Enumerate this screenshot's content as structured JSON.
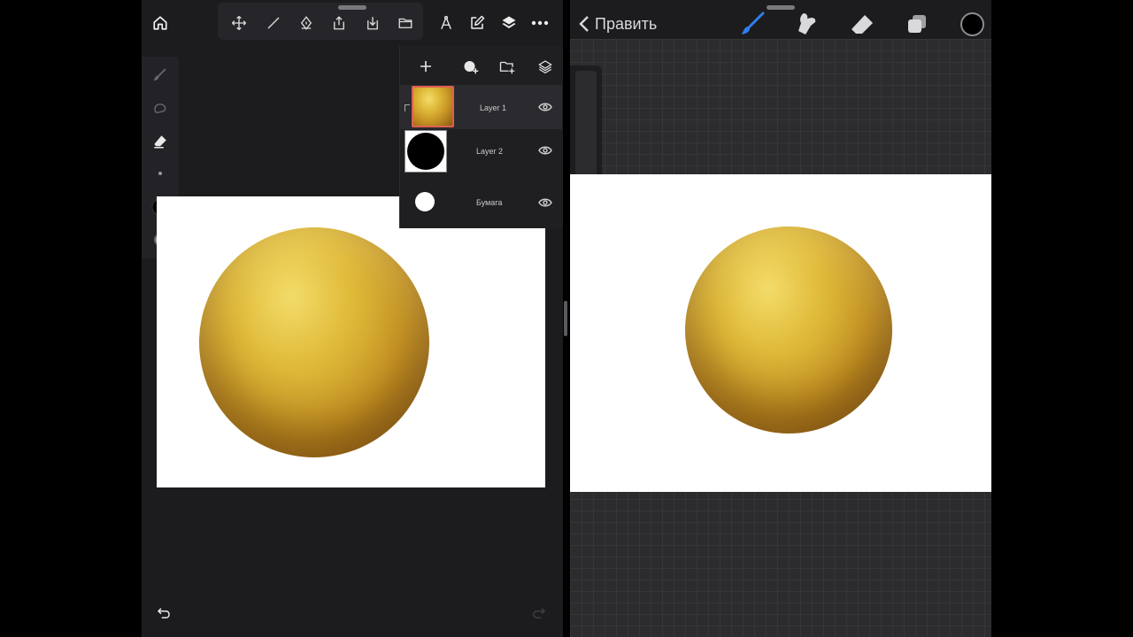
{
  "left_app": {
    "toolbar_icons": [
      "home-icon",
      "move-icon",
      "line-icon",
      "pen-tool-icon",
      "share-icon",
      "import-icon",
      "folder-icon",
      "compass-icon",
      "edit-icon",
      "layers-icon",
      "more-icon"
    ],
    "tools": [
      "brush-icon",
      "smudge-icon",
      "eraser-icon",
      "size-dot-icon",
      "color-black-icon",
      "opacity-icon"
    ],
    "layers_panel": {
      "actions": [
        "add-icon",
        "add-fill-layer-icon",
        "add-group-icon",
        "layers-stack-icon"
      ],
      "layers": [
        {
          "name": "Layer 1",
          "active": true
        },
        {
          "name": "Layer 2",
          "active": false
        },
        {
          "name": "Бумага",
          "active": false
        }
      ]
    }
  },
  "right_app": {
    "back_label": "Править",
    "tools": [
      "brush-icon",
      "smudge-icon",
      "eraser-icon",
      "layers-icon"
    ],
    "accent_color": "#2f7ff0",
    "current_color": "#000000"
  },
  "colors": {
    "app_bg": "#1c1c1e",
    "canvas": "#ffffff",
    "gold": "#d4a936",
    "active_layer_border": "#e0604f"
  }
}
